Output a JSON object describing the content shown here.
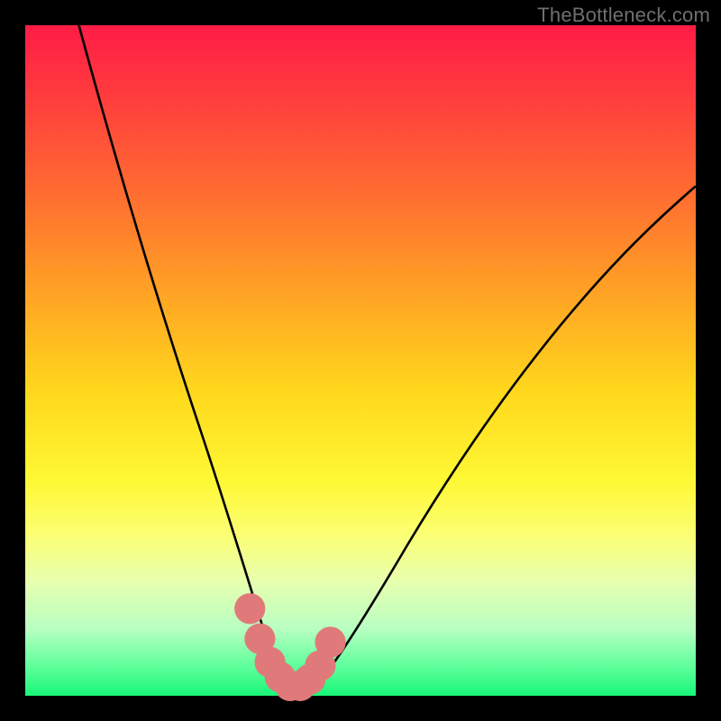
{
  "watermark": "TheBottleneck.com",
  "chart_data": {
    "type": "line",
    "title": "",
    "xlabel": "",
    "ylabel": "",
    "xlim": [
      0,
      100
    ],
    "ylim": [
      0,
      100
    ],
    "background_gradient_stops": [
      {
        "pos": 0,
        "color": "#ff1c46"
      },
      {
        "pos": 10,
        "color": "#ff3a3e"
      },
      {
        "pos": 26,
        "color": "#ff7030"
      },
      {
        "pos": 40,
        "color": "#ffa324"
      },
      {
        "pos": 55,
        "color": "#ffd91c"
      },
      {
        "pos": 68,
        "color": "#fff835"
      },
      {
        "pos": 76,
        "color": "#fbff74"
      },
      {
        "pos": 83,
        "color": "#e7ffaf"
      },
      {
        "pos": 90,
        "color": "#b8ffc2"
      },
      {
        "pos": 96,
        "color": "#59ff98"
      },
      {
        "pos": 100,
        "color": "#18f57a"
      }
    ],
    "series": [
      {
        "name": "bottleneck-curve",
        "color": "#000000",
        "x": [
          8,
          12,
          16,
          20,
          24,
          28,
          31,
          33,
          35,
          37,
          39,
          41,
          43,
          45,
          48,
          52,
          56,
          60,
          65,
          70,
          76,
          82,
          88,
          94,
          100
        ],
        "y": [
          100,
          84,
          69,
          55,
          42,
          30,
          21,
          15,
          10,
          6,
          3,
          1,
          1,
          2,
          5,
          11,
          18,
          25,
          33,
          41,
          49,
          57,
          64,
          70,
          76
        ]
      }
    ],
    "highlight": {
      "name": "sweet-spot",
      "color": "#e07a7a",
      "points_x": [
        33.5,
        35,
        36.5,
        38,
        39.5,
        41,
        42.5,
        44,
        45.5
      ],
      "points_y": [
        13,
        8.5,
        5,
        2.8,
        1.5,
        1.5,
        2.5,
        4.5,
        8
      ],
      "marker_radius": 2.3
    }
  }
}
